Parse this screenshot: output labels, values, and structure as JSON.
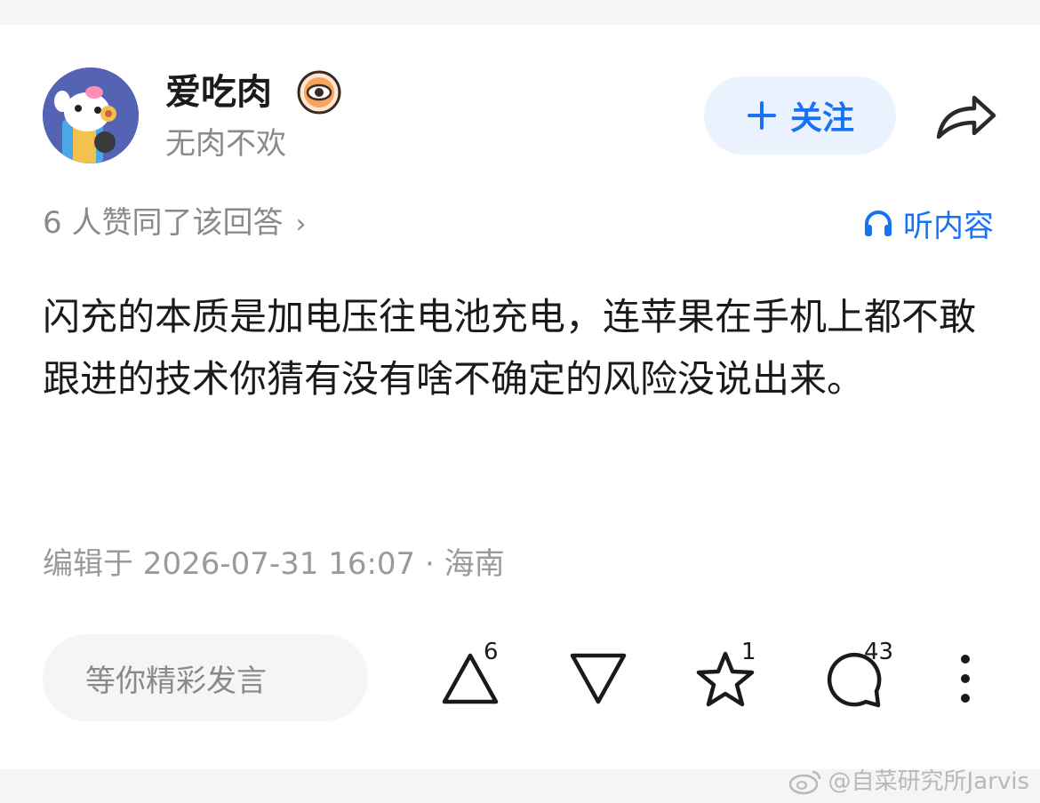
{
  "author": {
    "name": "爱吃肉",
    "bio": "无肉不欢",
    "avatar_icon": "cartoon-avatar",
    "badge_icon": "eye-badge-icon"
  },
  "header": {
    "follow_label": "关注",
    "follow_icon": "plus-icon",
    "share_icon": "share-arrow-icon"
  },
  "meta": {
    "likes_summary": "6 人赞同了该回答",
    "likes_chevron": "›",
    "listen_label": "听内容",
    "listen_icon": "headphones-icon"
  },
  "answer": {
    "text": "闪充的本质是加电压往电池充电，连苹果在手机上都不敢跟进的技术你猜有没有啥不确定的风险没说出来。"
  },
  "edit_info": "编辑于 2026-07-31 16:07 · 海南",
  "bottom_bar": {
    "comment_placeholder": "等你精彩发言",
    "upvote_count": "6",
    "star_count": "1",
    "comment_count": "43"
  },
  "watermark": {
    "text": "@自菜研究所Jarvis",
    "icon": "weibo-icon"
  },
  "colors": {
    "accent": "#1772f6",
    "follow_bg": "#eaf2fd",
    "muted_text": "#8a8a8a",
    "avatar_bg": "#5a67b8"
  }
}
